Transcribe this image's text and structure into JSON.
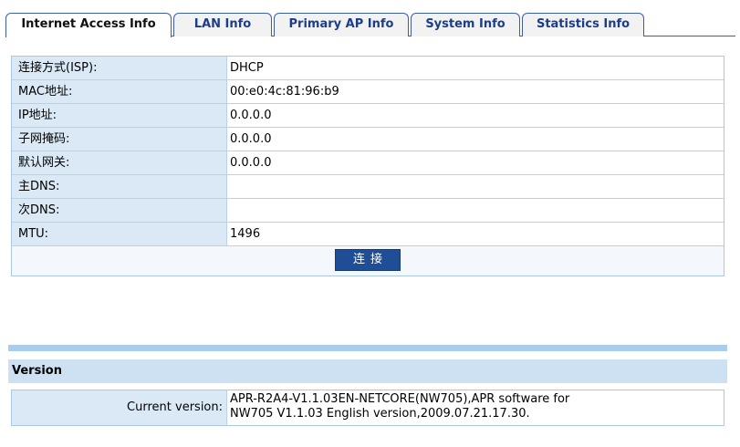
{
  "tabs": [
    {
      "label": "Internet Access Info",
      "active": true
    },
    {
      "label": "LAN Info",
      "active": false
    },
    {
      "label": "Primary AP Info",
      "active": false
    },
    {
      "label": "System Info",
      "active": false
    },
    {
      "label": "Statistics Info",
      "active": false
    }
  ],
  "internet_info": {
    "rows": [
      {
        "label": "连接方式(ISP):",
        "value": "DHCP"
      },
      {
        "label": "MAC地址:",
        "value": "00:e0:4c:81:96:b9"
      },
      {
        "label": "IP地址:",
        "value": "0.0.0.0"
      },
      {
        "label": "子网掩码:",
        "value": "0.0.0.0"
      },
      {
        "label": "默认网关:",
        "value": "0.0.0.0"
      },
      {
        "label": "主DNS:",
        "value": ""
      },
      {
        "label": "次DNS:",
        "value": ""
      },
      {
        "label": "MTU:",
        "value": "1496"
      }
    ],
    "connect_button": "连接"
  },
  "version": {
    "header": "Version",
    "label": "Current version:",
    "line1": "APR-R2A4-V1.1.03EN-NETCORE(NW705),APR software for",
    "line2": "NW705 V1.1.03 English version,2009.07.21.17.30."
  },
  "colors": {
    "tab_text": "#1c3d8c",
    "label_bg": "#dbe9f6",
    "button_bg": "#1f4e96",
    "separator": "#a9cdea"
  }
}
